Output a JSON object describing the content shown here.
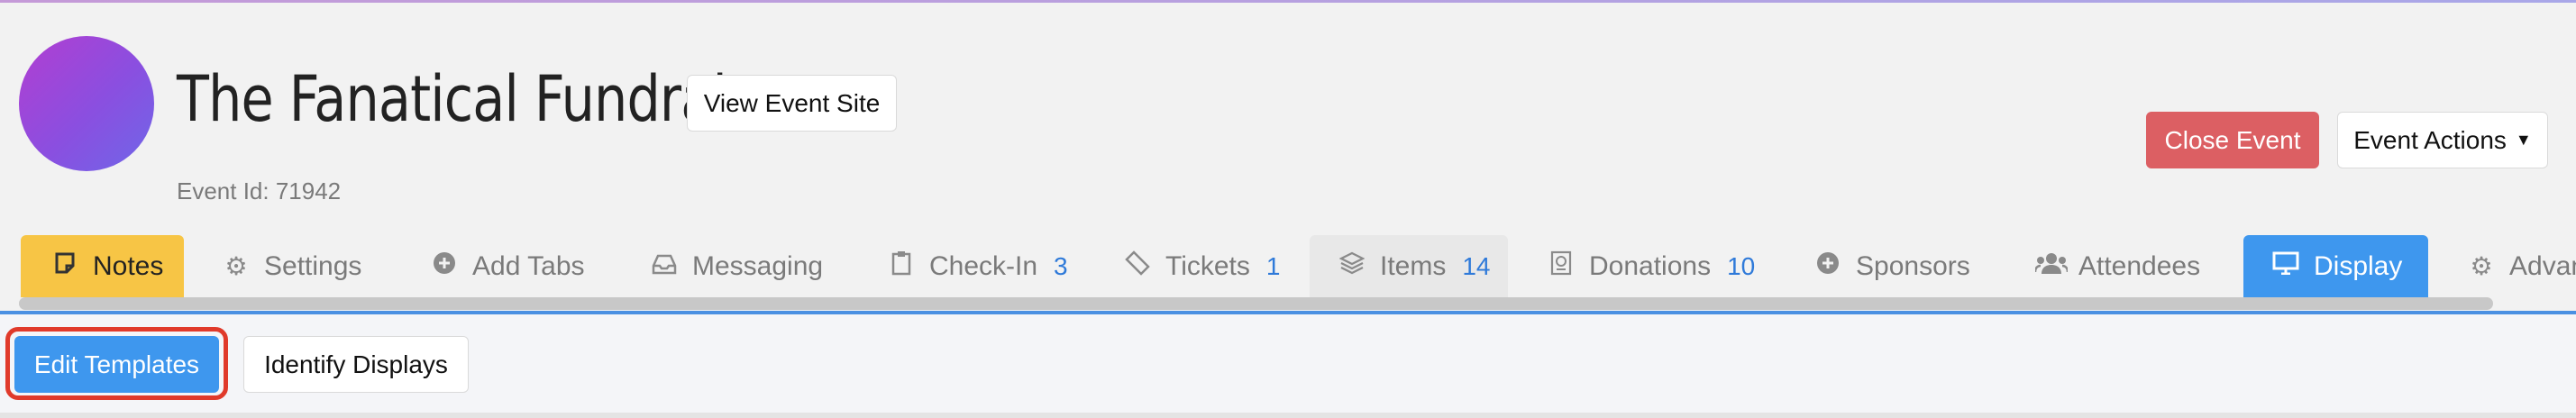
{
  "event": {
    "title": "The Fanatical Fundraiser",
    "id_label": "Event Id: 71942",
    "avatar_color": "#9b4ee0"
  },
  "header": {
    "view_site_label": "View Event Site",
    "close_event_label": "Close Event",
    "event_actions_label": "Event Actions"
  },
  "tabs": [
    {
      "label": "Notes",
      "icon": "note-icon",
      "count": ""
    },
    {
      "label": "Settings",
      "icon": "gear-icon",
      "count": ""
    },
    {
      "label": "Add Tabs",
      "icon": "plus-circle-icon",
      "count": ""
    },
    {
      "label": "Messaging",
      "icon": "inbox-icon",
      "count": ""
    },
    {
      "label": "Check-In",
      "icon": "clipboard-icon",
      "count": "3"
    },
    {
      "label": "Tickets",
      "icon": "ticket-icon",
      "count": "1"
    },
    {
      "label": "Items",
      "icon": "layers-icon",
      "count": "14"
    },
    {
      "label": "Donations",
      "icon": "donation-icon",
      "count": "10"
    },
    {
      "label": "Sponsors",
      "icon": "plus-circle-icon",
      "count": ""
    },
    {
      "label": "Attendees",
      "icon": "users-icon",
      "count": ""
    },
    {
      "label": "Display",
      "icon": "monitor-icon",
      "count": ""
    },
    {
      "label": "Advan",
      "icon": "gears-icon",
      "count": ""
    }
  ],
  "active_tab": "Display",
  "subnav": {
    "edit_templates_label": "Edit Templates",
    "identify_displays_label": "Identify Displays"
  },
  "colors": {
    "notes_tab": "#f7c545",
    "active_tab": "#3e97ee",
    "close_event": "#dc5f63",
    "highlight": "#e03a2b",
    "count": "#2f7ad9"
  }
}
